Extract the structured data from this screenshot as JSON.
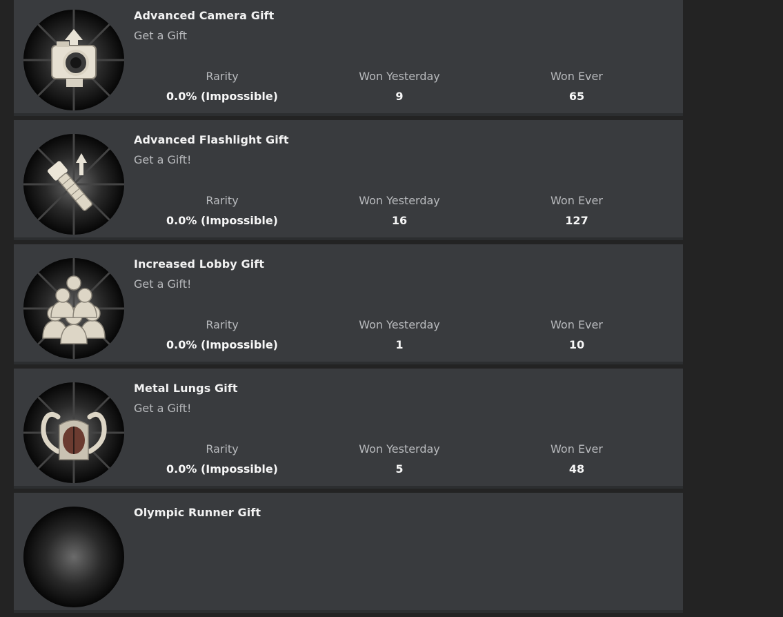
{
  "badges": [
    {
      "name": "Advanced Camera Gift",
      "description": "Get a Gift",
      "icon": "camera-upgrade-icon",
      "rarity_label": "Rarity",
      "rarity_value": "0.0% (Impossible)",
      "won_yesterday_label": "Won Yesterday",
      "won_yesterday_value": "9",
      "won_ever_label": "Won Ever",
      "won_ever_value": "65"
    },
    {
      "name": "Advanced Flashlight Gift",
      "description": "Get a Gift!",
      "icon": "flashlight-upgrade-icon",
      "rarity_label": "Rarity",
      "rarity_value": "0.0% (Impossible)",
      "won_yesterday_label": "Won Yesterday",
      "won_yesterday_value": "16",
      "won_ever_label": "Won Ever",
      "won_ever_value": "127"
    },
    {
      "name": "Increased Lobby Gift",
      "description": "Get a Gift!",
      "icon": "lobby-group-icon",
      "rarity_label": "Rarity",
      "rarity_value": "0.0% (Impossible)",
      "won_yesterday_label": "Won Yesterday",
      "won_yesterday_value": "1",
      "won_ever_label": "Won Ever",
      "won_ever_value": "10"
    },
    {
      "name": "Metal Lungs Gift",
      "description": "Get a Gift!",
      "icon": "metal-lungs-icon",
      "rarity_label": "Rarity",
      "rarity_value": "0.0% (Impossible)",
      "won_yesterday_label": "Won Yesterday",
      "won_yesterday_value": "5",
      "won_ever_label": "Won Ever",
      "won_ever_value": "48"
    },
    {
      "name": "Olympic Runner Gift",
      "icon": "runner-icon"
    }
  ]
}
